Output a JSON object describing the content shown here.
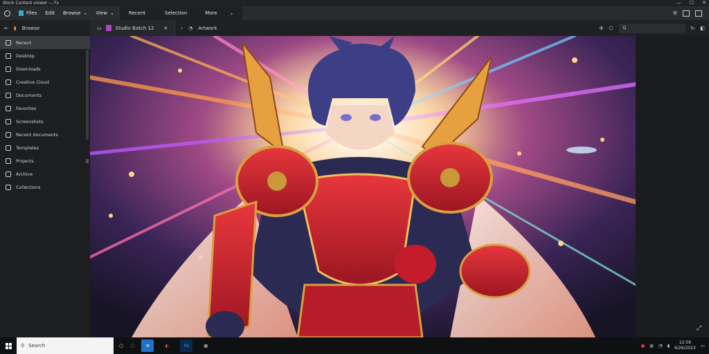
{
  "window": {
    "title": "Stock Content viewer — Fx"
  },
  "toolbar": {
    "file_label": "Files",
    "edit_label": "Edit",
    "browse_label": "Browse",
    "view_label": "View",
    "recent_label": "Recent",
    "selection_label": "Selection",
    "more_label": "More"
  },
  "tabs": [
    {
      "label": "Studio Batch 12"
    }
  ],
  "address": {
    "label": "Artwork"
  },
  "search": {
    "placeholder": "Q"
  },
  "sidebar": {
    "items": [
      {
        "label": "Recent"
      },
      {
        "label": "Desktop"
      },
      {
        "label": "Downloads"
      },
      {
        "label": "Creative Cloud"
      },
      {
        "label": "Documents"
      },
      {
        "label": "Favorites"
      },
      {
        "label": "Screenshots"
      },
      {
        "label": "Recent documents"
      },
      {
        "label": "Templates"
      },
      {
        "label": "Projects"
      },
      {
        "label": "Archive"
      },
      {
        "label": "Collections"
      }
    ]
  },
  "taskbar": {
    "search_placeholder": "Search",
    "time": "12:58",
    "date": "6/26/2023"
  },
  "colors": {
    "accent": "#1e73c8",
    "pink_tab": "#b146c2"
  }
}
